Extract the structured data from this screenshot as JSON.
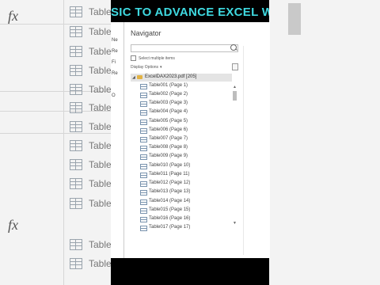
{
  "banner": {
    "text": "SIC TO ADVANCE EXCEL WITH ARRA"
  },
  "background": {
    "fx_symbol": "fx",
    "table_labels": [
      "Table",
      "Table",
      "Table",
      "Table",
      "Table",
      "Table",
      "Table",
      "Table",
      "Table",
      "Table",
      "Table",
      "Table",
      "Table"
    ]
  },
  "side_strip": {
    "labels": [
      "Ne",
      "Re",
      "Fi",
      "Re",
      "O"
    ]
  },
  "dialog": {
    "title": "Navigator",
    "search_placeholder": "",
    "select_multiple_label": "Select multiple items",
    "display_options_label": "Display Options",
    "root": {
      "label": "ExcelDAX2023.pdf [205]"
    },
    "items": [
      "Table001 (Page 1)",
      "Table002 (Page 2)",
      "Table003 (Page 3)",
      "Table004 (Page 4)",
      "Table005 (Page 5)",
      "Table006 (Page 6)",
      "Table007 (Page 7)",
      "Table008 (Page 8)",
      "Table009 (Page 9)",
      "Table010 (Page 10)",
      "Table011 (Page 11)",
      "Table012 (Page 12)",
      "Table013 (Page 13)",
      "Table014 (Page 14)",
      "Table015 (Page 15)",
      "Table016 (Page 16)",
      "Table017 (Page 17)"
    ]
  },
  "icons": {
    "fx": "function-icon",
    "table": "table-icon",
    "folder": "folder-icon",
    "search": "search-icon",
    "refresh": "refresh-icon"
  },
  "colors": {
    "banner_text": "#3fd9e0",
    "folder": "#e2b244",
    "selected_row": "#e4e4e4"
  }
}
